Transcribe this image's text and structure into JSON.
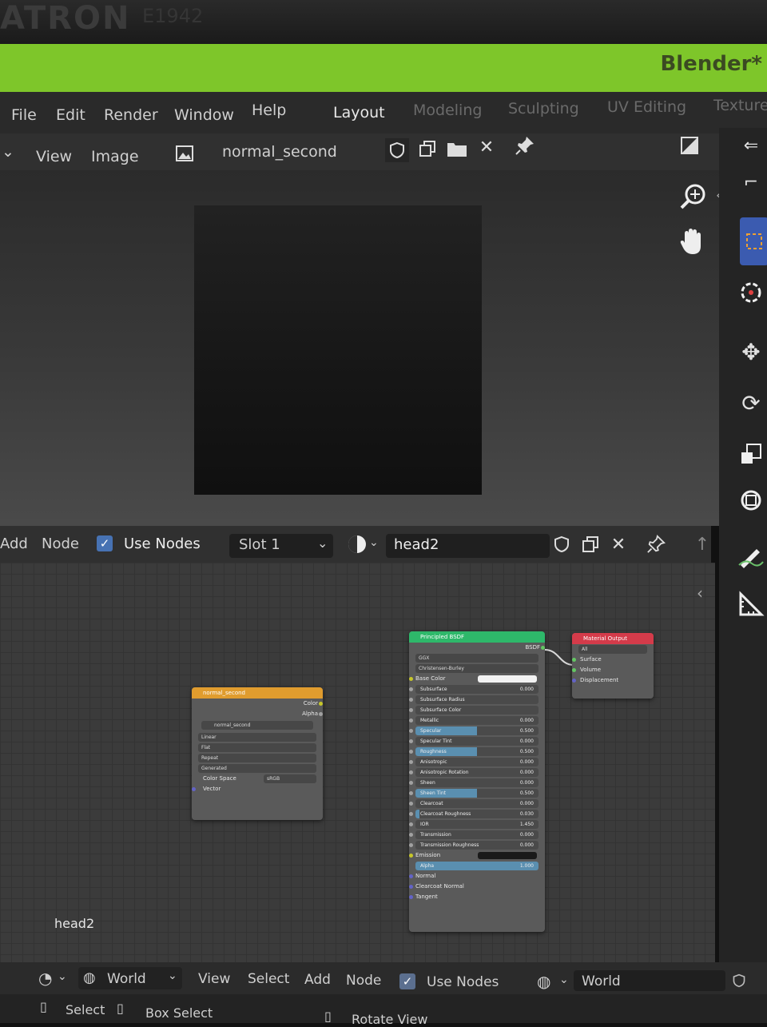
{
  "bezel": {
    "brand": "ATRON",
    "model": "E1942"
  },
  "app_title": "Blender*",
  "top_menu": [
    "File",
    "Edit",
    "Render",
    "Window",
    "Help"
  ],
  "workspaces": [
    "Layout",
    "Modeling",
    "Sculpting",
    "UV Editing",
    "Texture"
  ],
  "active_workspace": "Layout",
  "image_editor": {
    "menu": [
      "View",
      "Image"
    ],
    "image_name": "normal_second"
  },
  "node_editor": {
    "menu": [
      "Add",
      "Node"
    ],
    "use_nodes_label": "Use Nodes",
    "use_nodes_checked": true,
    "slot": "Slot 1",
    "material": "head2",
    "overlay_label": "head2"
  },
  "image_node": {
    "title": "normal_second",
    "outputs": [
      "Color",
      "Alpha"
    ],
    "image": "normal_second",
    "interpolation": "Linear",
    "projection": "Flat",
    "extension": "Repeat",
    "source": "Generated",
    "color_space_label": "Color Space",
    "color_space": "sRGB",
    "input": "Vector"
  },
  "bsdf_node": {
    "title": "Principled BSDF",
    "output": "BSDF",
    "distribution": "GGX",
    "subsurface_method": "Christensen-Burley",
    "base_color_label": "Base Color",
    "sliders": [
      {
        "label": "Subsurface",
        "value": "0.000",
        "fill": 0.0
      },
      {
        "label": "Subsurface Radius",
        "value": "",
        "fill": 0.0
      },
      {
        "label": "Subsurface Color",
        "value": "",
        "fill": 0.0
      },
      {
        "label": "Metallic",
        "value": "0.000",
        "fill": 0.0
      },
      {
        "label": "Specular",
        "value": "0.500",
        "fill": 0.5
      },
      {
        "label": "Specular Tint",
        "value": "0.000",
        "fill": 0.0
      },
      {
        "label": "Roughness",
        "value": "0.500",
        "fill": 0.5
      },
      {
        "label": "Anisotropic",
        "value": "0.000",
        "fill": 0.0
      },
      {
        "label": "Anisotropic Rotation",
        "value": "0.000",
        "fill": 0.0
      },
      {
        "label": "Sheen",
        "value": "0.000",
        "fill": 0.0
      },
      {
        "label": "Sheen Tint",
        "value": "0.500",
        "fill": 0.5
      },
      {
        "label": "Clearcoat",
        "value": "0.000",
        "fill": 0.0
      },
      {
        "label": "Clearcoat Roughness",
        "value": "0.030",
        "fill": 0.03
      },
      {
        "label": "IOR",
        "value": "1.450",
        "fill": 0.0
      },
      {
        "label": "Transmission",
        "value": "0.000",
        "fill": 0.0
      },
      {
        "label": "Transmission Roughness",
        "value": "0.000",
        "fill": 0.0
      }
    ],
    "emission_label": "Emission",
    "alpha_label": "Alpha",
    "alpha_value": "1.000",
    "inputs_tail": [
      "Normal",
      "Clearcoat Normal",
      "Tangent"
    ]
  },
  "output_node": {
    "title": "Material Output",
    "target": "All",
    "inputs": [
      "Surface",
      "Volume",
      "Displacement"
    ]
  },
  "bottom_header": {
    "world_label": "World",
    "menu": [
      "View",
      "Select",
      "Add",
      "Node"
    ],
    "use_nodes_label": "Use Nodes",
    "world_field": "World"
  },
  "status_bar": {
    "items": [
      "Select",
      "Box Select",
      "Rotate View"
    ]
  },
  "colors": {
    "title_bar": "#7ec62a",
    "image_node_header": "#e09c2e",
    "bsdf_node_header": "#2eb86a",
    "output_node_header": "#d43b4a",
    "accent": "#4772b3"
  }
}
